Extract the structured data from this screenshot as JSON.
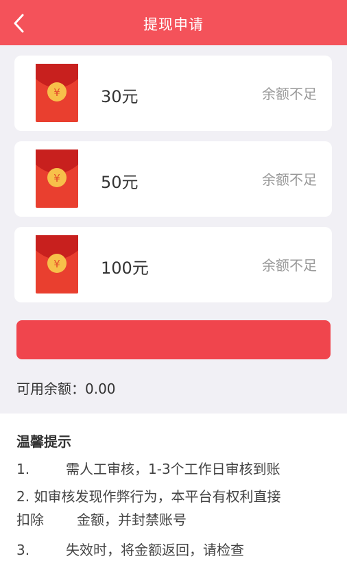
{
  "header": {
    "title": "提现申请",
    "bg_color": "#f4525a"
  },
  "options": [
    {
      "amount": "30元",
      "status": "余额不足"
    },
    {
      "amount": "50元",
      "status": "余额不足"
    },
    {
      "amount": "100元",
      "status": "余额不足"
    }
  ],
  "balance": {
    "text": "可用余额：0.00"
  },
  "submit": {
    "label": "",
    "color": "#f0454d"
  },
  "tips": {
    "title": "温馨提示",
    "items": [
      {
        "num": "1.",
        "text": "需人工审核，1-3个工作日审核到账"
      },
      {
        "line1": "2. 如审核发现作弊行为，本平台有权利直接",
        "line2a": "扣除",
        "line2b": "金额，并封禁账号"
      },
      {
        "num": "3.",
        "text": "失效时，将金额返回，请检查"
      }
    ]
  },
  "icons": {
    "back": "chevron-left-icon",
    "envelope": "red-envelope-icon",
    "coin": "yuan-coin-icon"
  }
}
